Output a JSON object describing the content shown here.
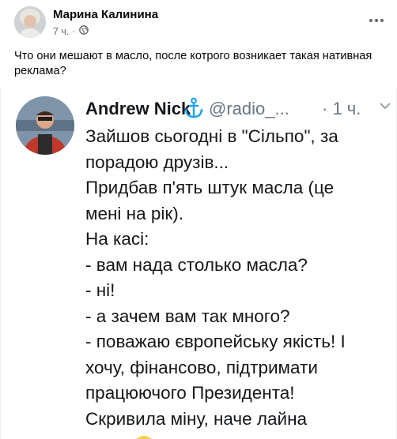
{
  "post": {
    "author": "Марина Калинина",
    "time": "7 ч.",
    "separator": "·",
    "text": "Что они мешают в масло, после котрого возникает такая нативная реклама?"
  },
  "tweet": {
    "name": "Andrew Nick",
    "handle": "@radio_...",
    "time": "· 1 ч.",
    "lines": [
      "Зайшов сьогодні в \"Сільпо\", за",
      "порадою друзів...",
      "Придбав п'ять штук масла (це",
      "мені на рік).",
      "На касі:",
      "- вам нада столько масла?",
      "- ні!",
      "- а зачем вам так много?",
      "- поважаю європейську якість! І",
      "хочу, фінансово, підтримати",
      "працюючого Президента!",
      "Скривила міну, наче лайна"
    ]
  },
  "colors": {
    "text_primary": "#050505",
    "text_secondary": "#65676b",
    "tweet_secondary": "#687684",
    "anchor": "#1da1f2"
  },
  "icons": [
    "globe-icon",
    "more-options-icon",
    "anchor-icon",
    "chevron-down-icon"
  ]
}
